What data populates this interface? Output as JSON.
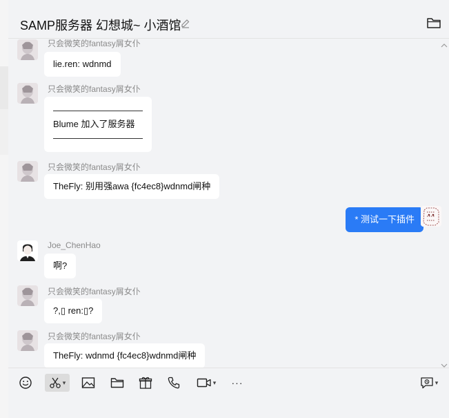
{
  "header": {
    "title": "SAMP服务器 幻想城~ 小酒馆"
  },
  "messages": [
    {
      "sender": "只会微笑的fantasy屑女仆",
      "lines": [
        "lie.ren: wdnmd"
      ]
    },
    {
      "sender": "只会微笑的fantasy屑女仆",
      "lines": [
        "——————————",
        "Blume 加入了服务器",
        "——————————"
      ]
    },
    {
      "sender": "只会微笑的fantasy屑女仆",
      "lines": [
        "TheFly: 别用强awa  {fc4ec8}wdnmd闸种"
      ]
    },
    {
      "self": true,
      "lines": [
        "* 测试一下插件"
      ]
    },
    {
      "sender": "Joe_ChenHao",
      "lines": [
        "啊?"
      ]
    },
    {
      "sender": "只会微笑的fantasy屑女仆",
      "lines": [
        "?,▯ ren:▯?"
      ]
    },
    {
      "sender": "只会微笑的fantasy屑女仆",
      "lines": [
        "TheFly: wdnmd  {fc4ec8}wdnmd闸种"
      ]
    }
  ],
  "toolbar": {
    "tools": [
      "emoji-icon",
      "scissors-icon",
      "image-icon",
      "folder-icon",
      "gift-icon",
      "phone-icon",
      "video-icon",
      "more-icon",
      "history-icon"
    ],
    "more_label": "···"
  }
}
